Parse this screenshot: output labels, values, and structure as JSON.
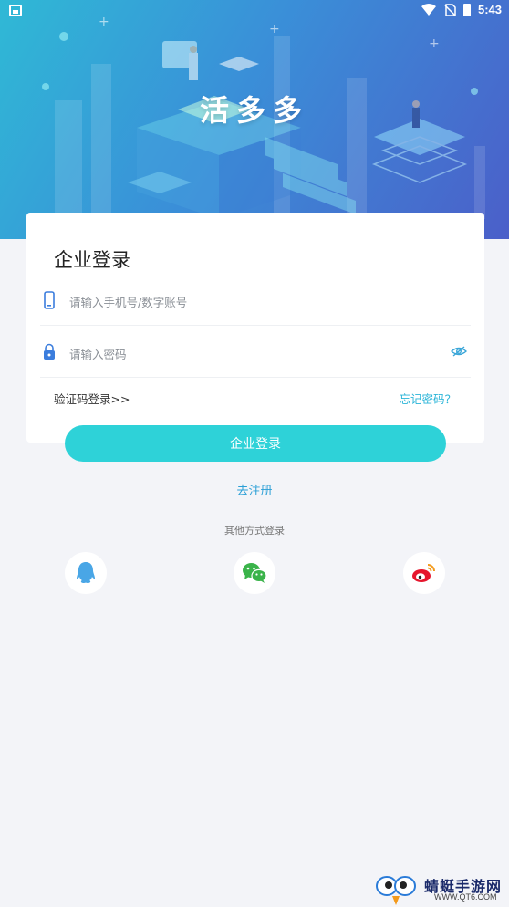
{
  "status_bar": {
    "time": "5:43"
  },
  "app": {
    "title": "活多多"
  },
  "login_card": {
    "title": "企业登录",
    "phone_placeholder": "请输入手机号/数字账号",
    "password_placeholder": "请输入密码",
    "sms_login_link": "验证码登录>>",
    "forgot_password_link": "忘记密码？"
  },
  "actions": {
    "login_button": "企业登录",
    "register_link": "去注册",
    "other_login_text": "其他方式登录"
  },
  "social": [
    "qq-icon",
    "wechat-icon",
    "weibo-icon"
  ],
  "watermark": {
    "text": "蜻蜓手游网",
    "url": "WWW.QT6.COM"
  },
  "colors": {
    "accent": "#2ed2d8",
    "link": "#2bb5d8",
    "hero_start": "#2fb9d6",
    "hero_end": "#4b5fc9"
  }
}
